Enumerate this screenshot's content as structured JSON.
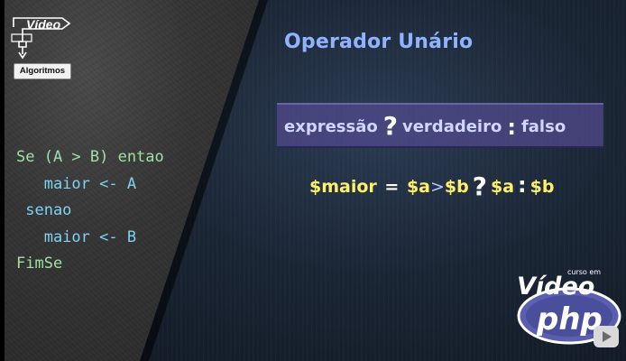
{
  "logo": {
    "word": "Vídeo",
    "label": "Algoritmos"
  },
  "pseudocode": {
    "lines": [
      "Se (A > B) entao",
      "   maior <- A",
      " senao",
      "   maior <- B",
      "FimSe"
    ]
  },
  "slide": {
    "title": "Operador Unário",
    "expression": {
      "part1": "expressão",
      "q": "?",
      "part2": "verdadeiro",
      "colon": ":",
      "part3": "falso"
    },
    "code": {
      "var": "$maior",
      "eq": "=",
      "a": "$a",
      "gt": ">",
      "b": "$b",
      "q": "?",
      "ra": "$a",
      "colon": ":",
      "rb": "$b"
    }
  },
  "branding": {
    "small": "curso em",
    "video": "Vídeo",
    "php": "php"
  },
  "colors": {
    "chalk_green": "#9fe0a4",
    "keyword_blue": "#7ed3f0",
    "title_blue": "#8fb3ff",
    "code_yellow": "#fff06a",
    "php_purple": "#5b5fb0"
  },
  "icons": {
    "play": "play-icon"
  }
}
